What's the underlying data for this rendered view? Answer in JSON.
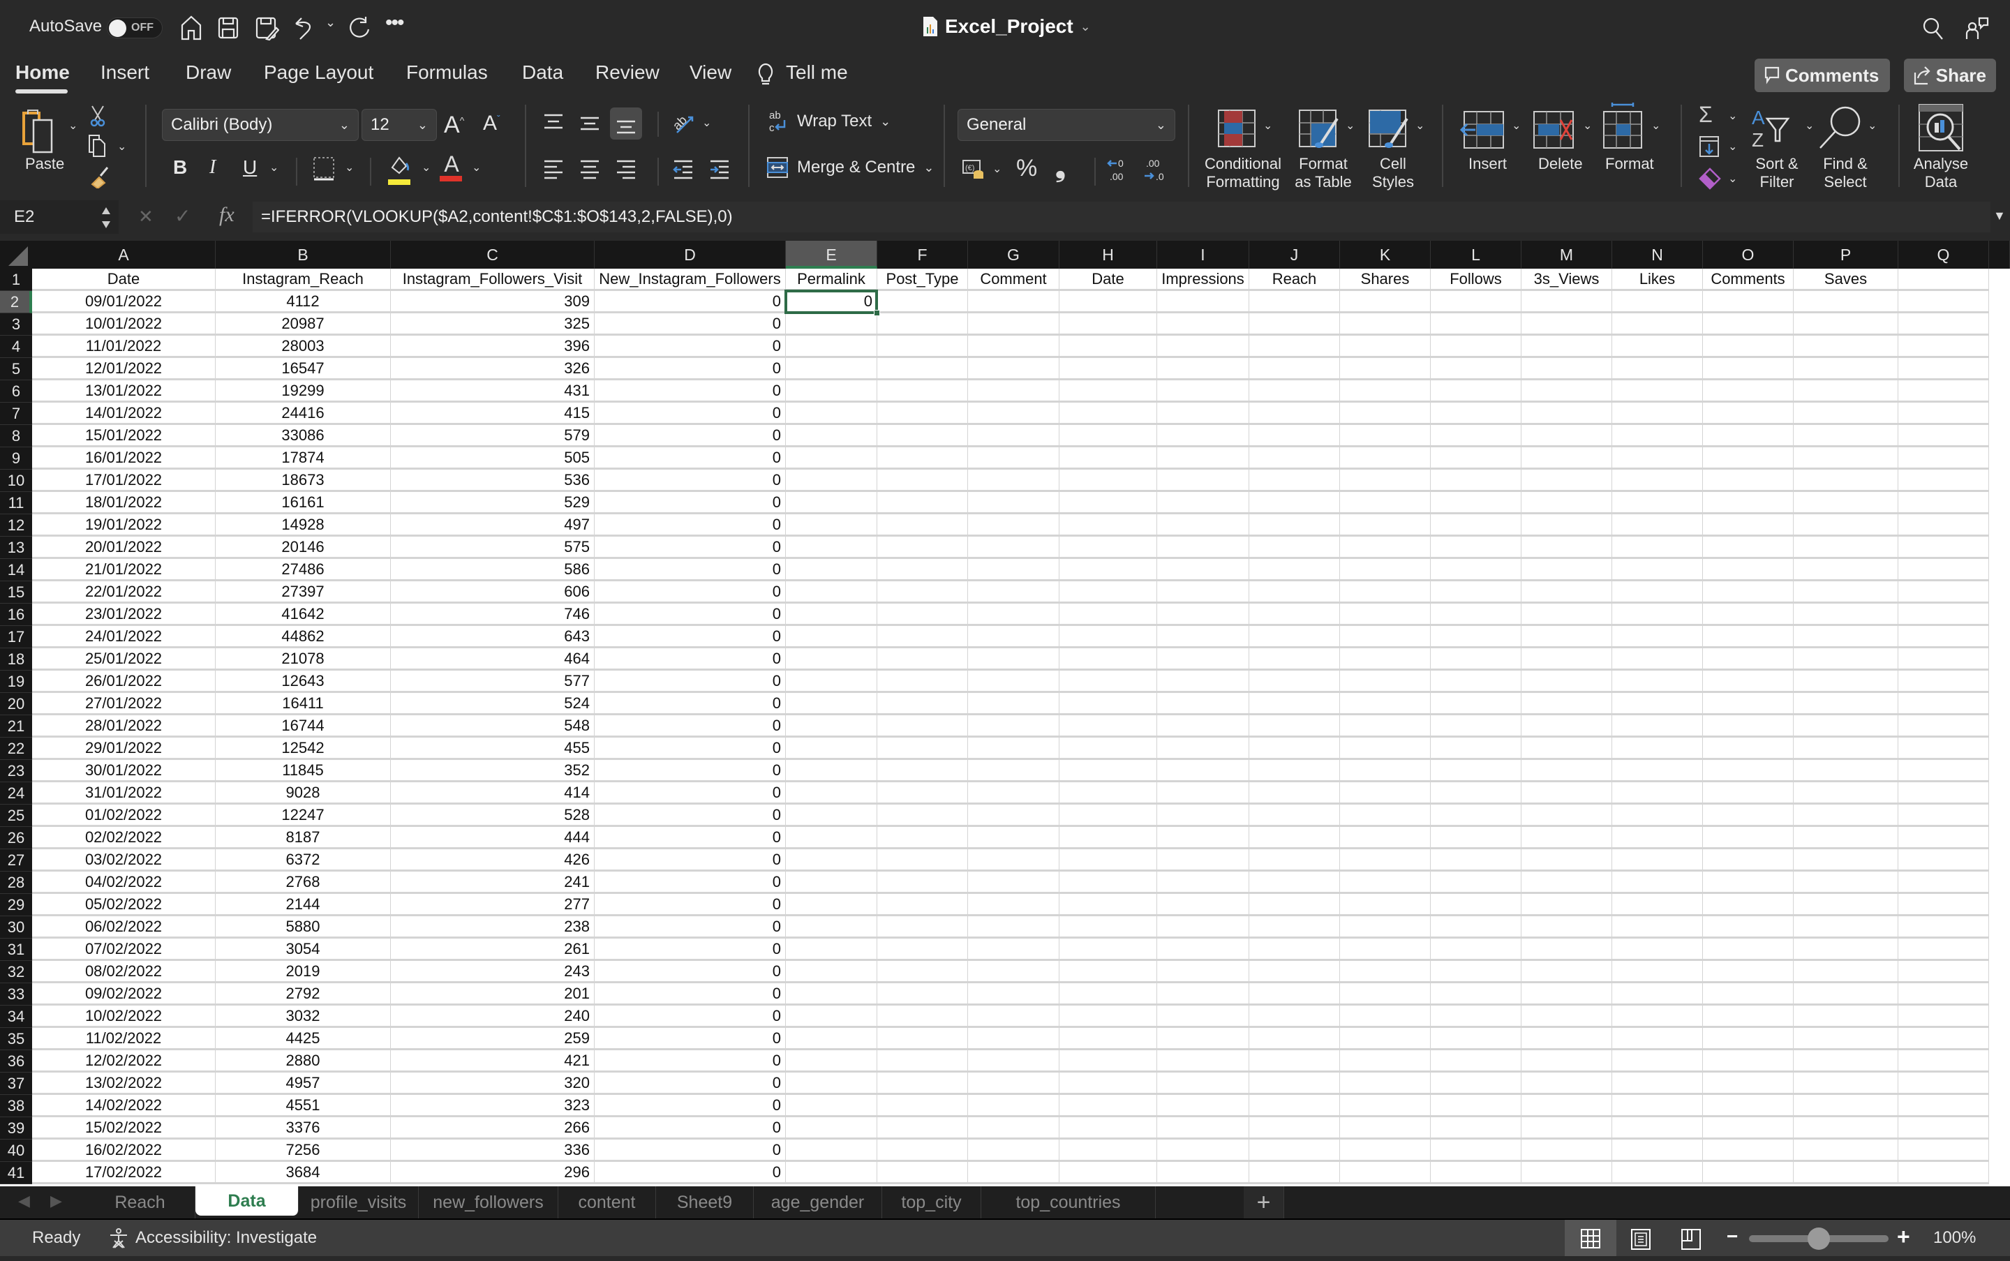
{
  "titlebar": {
    "autosave_label": "AutoSave",
    "autosave_state": "OFF",
    "doc_title": "Excel_Project",
    "icons": [
      "home-icon",
      "save-icon",
      "save-as-icon",
      "undo-icon",
      "redo-icon",
      "more-icon",
      "search-icon",
      "share-people-icon"
    ]
  },
  "ribbon_tabs": [
    {
      "label": "Home",
      "active": true
    },
    {
      "label": "Insert"
    },
    {
      "label": "Draw"
    },
    {
      "label": "Page Layout"
    },
    {
      "label": "Formulas"
    },
    {
      "label": "Data"
    },
    {
      "label": "Review"
    },
    {
      "label": "View"
    }
  ],
  "tell_me": "Tell me",
  "comments_button": "Comments",
  "share_button": "Share",
  "ribbon": {
    "paste": "Paste",
    "font_name": "Calibri (Body)",
    "font_size": "12",
    "bold": "B",
    "italic": "I",
    "underline": "U",
    "wrap_text": "Wrap Text",
    "merge_centre": "Merge & Centre",
    "number_format": "General",
    "percent": "%",
    "comma": "❟",
    "conditional_formatting": [
      "Conditional",
      "Formatting"
    ],
    "format_as_table": [
      "Format",
      "as Table"
    ],
    "cell_styles": [
      "Cell",
      "Styles"
    ],
    "insert": "Insert",
    "delete": "Delete",
    "format": "Format",
    "sort_filter": [
      "Sort &",
      "Filter"
    ],
    "find_select": [
      "Find &",
      "Select"
    ],
    "analyse_data": [
      "Analyse",
      "Data"
    ],
    "fill_color": "#f5ea3a",
    "font_color": "#e0332a"
  },
  "formula_bar": {
    "name_box": "E2",
    "fx": "fx",
    "formula": "=IFERROR(VLOOKUP($A2,content!$C$1:$O$143,2,FALSE),0)"
  },
  "grid": {
    "columns": [
      "A",
      "B",
      "C",
      "D",
      "E",
      "F",
      "G",
      "H",
      "I",
      "J",
      "K",
      "L",
      "M",
      "N",
      "O",
      "P",
      "Q"
    ],
    "selected_column": "E",
    "selected_row": 2,
    "header_row": [
      "Date",
      "Instagram_Reach",
      "Instagram_Followers_Visit",
      "New_Instagram_Followers",
      "Permalink",
      "Post_Type",
      "Comment",
      "Date",
      "Impressions",
      "Reach",
      "Shares",
      "Follows",
      "3s_Views",
      "Likes",
      "Comments",
      "Saves",
      ""
    ],
    "rows": [
      {
        "n": 2,
        "date": "09/01/2022",
        "reach": "4112",
        "visits": "309",
        "new": "0",
        "permalink": "0"
      },
      {
        "n": 3,
        "date": "10/01/2022",
        "reach": "20987",
        "visits": "325",
        "new": "0"
      },
      {
        "n": 4,
        "date": "11/01/2022",
        "reach": "28003",
        "visits": "396",
        "new": "0"
      },
      {
        "n": 5,
        "date": "12/01/2022",
        "reach": "16547",
        "visits": "326",
        "new": "0"
      },
      {
        "n": 6,
        "date": "13/01/2022",
        "reach": "19299",
        "visits": "431",
        "new": "0"
      },
      {
        "n": 7,
        "date": "14/01/2022",
        "reach": "24416",
        "visits": "415",
        "new": "0"
      },
      {
        "n": 8,
        "date": "15/01/2022",
        "reach": "33086",
        "visits": "579",
        "new": "0"
      },
      {
        "n": 9,
        "date": "16/01/2022",
        "reach": "17874",
        "visits": "505",
        "new": "0"
      },
      {
        "n": 10,
        "date": "17/01/2022",
        "reach": "18673",
        "visits": "536",
        "new": "0"
      },
      {
        "n": 11,
        "date": "18/01/2022",
        "reach": "16161",
        "visits": "529",
        "new": "0"
      },
      {
        "n": 12,
        "date": "19/01/2022",
        "reach": "14928",
        "visits": "497",
        "new": "0"
      },
      {
        "n": 13,
        "date": "20/01/2022",
        "reach": "20146",
        "visits": "575",
        "new": "0"
      },
      {
        "n": 14,
        "date": "21/01/2022",
        "reach": "27486",
        "visits": "586",
        "new": "0"
      },
      {
        "n": 15,
        "date": "22/01/2022",
        "reach": "27397",
        "visits": "606",
        "new": "0"
      },
      {
        "n": 16,
        "date": "23/01/2022",
        "reach": "41642",
        "visits": "746",
        "new": "0"
      },
      {
        "n": 17,
        "date": "24/01/2022",
        "reach": "44862",
        "visits": "643",
        "new": "0"
      },
      {
        "n": 18,
        "date": "25/01/2022",
        "reach": "21078",
        "visits": "464",
        "new": "0"
      },
      {
        "n": 19,
        "date": "26/01/2022",
        "reach": "12643",
        "visits": "577",
        "new": "0"
      },
      {
        "n": 20,
        "date": "27/01/2022",
        "reach": "16411",
        "visits": "524",
        "new": "0"
      },
      {
        "n": 21,
        "date": "28/01/2022",
        "reach": "16744",
        "visits": "548",
        "new": "0"
      },
      {
        "n": 22,
        "date": "29/01/2022",
        "reach": "12542",
        "visits": "455",
        "new": "0"
      },
      {
        "n": 23,
        "date": "30/01/2022",
        "reach": "11845",
        "visits": "352",
        "new": "0"
      },
      {
        "n": 24,
        "date": "31/01/2022",
        "reach": "9028",
        "visits": "414",
        "new": "0"
      },
      {
        "n": 25,
        "date": "01/02/2022",
        "reach": "12247",
        "visits": "528",
        "new": "0"
      },
      {
        "n": 26,
        "date": "02/02/2022",
        "reach": "8187",
        "visits": "444",
        "new": "0"
      },
      {
        "n": 27,
        "date": "03/02/2022",
        "reach": "6372",
        "visits": "426",
        "new": "0"
      },
      {
        "n": 28,
        "date": "04/02/2022",
        "reach": "2768",
        "visits": "241",
        "new": "0"
      },
      {
        "n": 29,
        "date": "05/02/2022",
        "reach": "2144",
        "visits": "277",
        "new": "0"
      },
      {
        "n": 30,
        "date": "06/02/2022",
        "reach": "5880",
        "visits": "238",
        "new": "0"
      },
      {
        "n": 31,
        "date": "07/02/2022",
        "reach": "3054",
        "visits": "261",
        "new": "0"
      },
      {
        "n": 32,
        "date": "08/02/2022",
        "reach": "2019",
        "visits": "243",
        "new": "0"
      },
      {
        "n": 33,
        "date": "09/02/2022",
        "reach": "2792",
        "visits": "201",
        "new": "0"
      },
      {
        "n": 34,
        "date": "10/02/2022",
        "reach": "3032",
        "visits": "240",
        "new": "0"
      },
      {
        "n": 35,
        "date": "11/02/2022",
        "reach": "4425",
        "visits": "259",
        "new": "0"
      },
      {
        "n": 36,
        "date": "12/02/2022",
        "reach": "2880",
        "visits": "421",
        "new": "0"
      },
      {
        "n": 37,
        "date": "13/02/2022",
        "reach": "4957",
        "visits": "320",
        "new": "0"
      },
      {
        "n": 38,
        "date": "14/02/2022",
        "reach": "4551",
        "visits": "323",
        "new": "0"
      },
      {
        "n": 39,
        "date": "15/02/2022",
        "reach": "3376",
        "visits": "266",
        "new": "0"
      },
      {
        "n": 40,
        "date": "16/02/2022",
        "reach": "7256",
        "visits": "336",
        "new": "0"
      },
      {
        "n": 41,
        "date": "17/02/2022",
        "reach": "3684",
        "visits": "296",
        "new": "0"
      }
    ]
  },
  "sheet_tabs": [
    {
      "label": "Reach"
    },
    {
      "label": "Data",
      "active": true
    },
    {
      "label": "profile_visits"
    },
    {
      "label": "new_followers"
    },
    {
      "label": "content"
    },
    {
      "label": "Sheet9"
    },
    {
      "label": "age_gender"
    },
    {
      "label": "top_city"
    },
    {
      "label": "top_countries"
    }
  ],
  "add_sheet": "+",
  "status": {
    "ready": "Ready",
    "accessibility": "Accessibility: Investigate",
    "zoom_level": "100%",
    "zoom_fraction": 0.5
  }
}
